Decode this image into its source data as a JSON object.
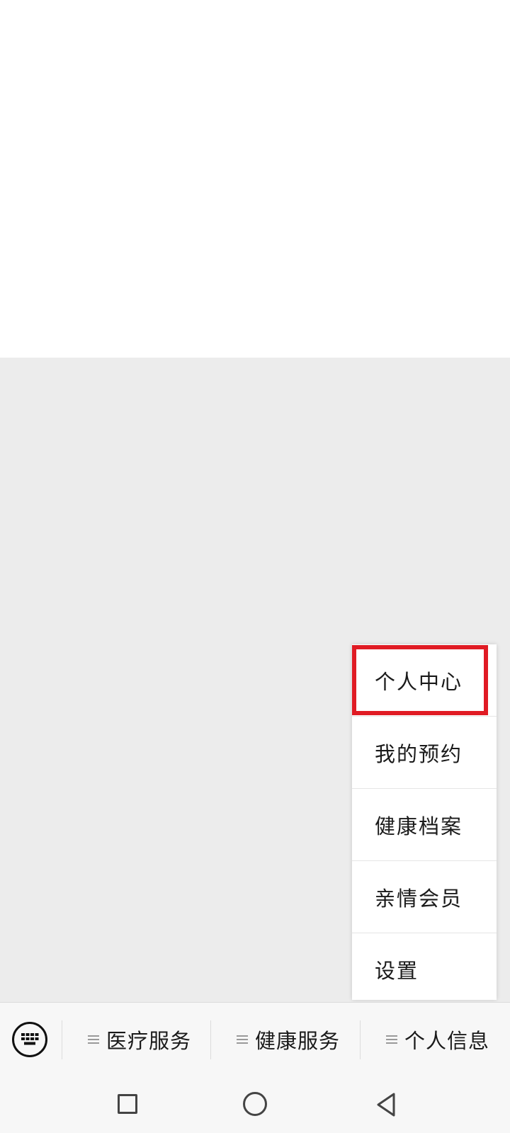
{
  "popup_menu": {
    "items": [
      {
        "label": "个人中心",
        "highlighted": true
      },
      {
        "label": "我的预约"
      },
      {
        "label": "健康档案"
      },
      {
        "label": "亲情会员"
      },
      {
        "label": "设置"
      }
    ],
    "highlight_color": "#e01b24"
  },
  "bottom_menu": {
    "keyboard_icon": "keyboard-icon",
    "tabs": [
      {
        "label": "医疗服务"
      },
      {
        "label": "健康服务"
      },
      {
        "label": "个人信息"
      }
    ]
  },
  "nav_bar": {
    "icons": [
      "recent-apps-icon",
      "home-icon",
      "back-icon"
    ]
  }
}
